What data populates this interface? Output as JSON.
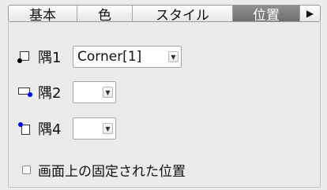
{
  "tabs": [
    {
      "label": "基本",
      "active": false
    },
    {
      "label": "色",
      "active": false
    },
    {
      "label": "スタイル",
      "active": false
    },
    {
      "label": "位置",
      "active": true
    }
  ],
  "tab_overflow_icon": "right-triangle-icon",
  "corners": [
    {
      "label": "隅1",
      "value": "Corner[1]",
      "dot_position": "bottom-left",
      "dot_color": "#000000"
    },
    {
      "label": "隅2",
      "value": "",
      "dot_position": "bottom-right",
      "dot_color": "#0000ff"
    },
    {
      "label": "隅4",
      "value": "",
      "dot_position": "top-left",
      "dot_color": "#0000ff"
    }
  ],
  "fixed_position": {
    "label": "画面上の固定された位置",
    "checked": false
  }
}
